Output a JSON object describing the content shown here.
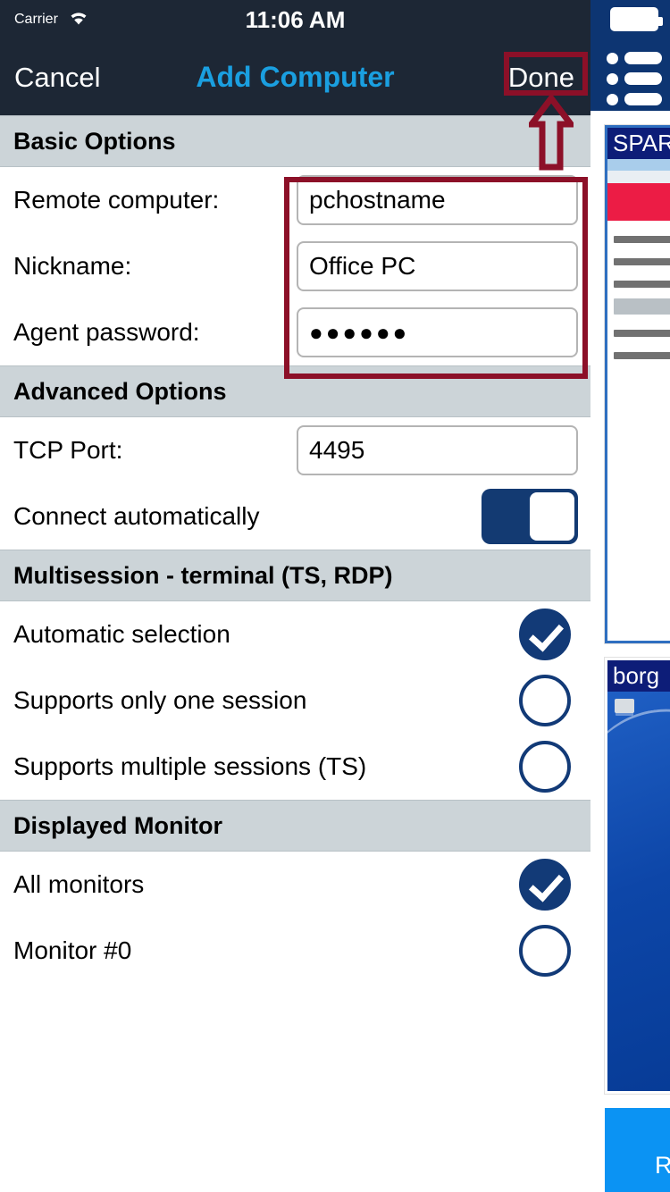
{
  "status_bar": {
    "carrier": "Carrier",
    "wifi_icon": "wifi-icon",
    "time": "11:06 AM"
  },
  "nav_bar": {
    "cancel_label": "Cancel",
    "title": "Add Computer",
    "done_label": "Done",
    "title_color": "#1a9fe0",
    "background_color": "#1d2735"
  },
  "sections": {
    "basic": {
      "header": "Basic Options",
      "rows": [
        {
          "label": "Remote computer:",
          "value": "pchostname",
          "type": "text"
        },
        {
          "label": "Nickname:",
          "value": "Office PC",
          "type": "text"
        },
        {
          "label": "Agent password:",
          "value": "●●●●●●",
          "type": "password"
        }
      ]
    },
    "advanced": {
      "header": "Advanced Options",
      "tcp_port_label": "TCP Port:",
      "tcp_port_value": "4495",
      "connect_auto_label": "Connect automatically",
      "connect_auto_state": "on"
    },
    "multisession": {
      "header": "Multisession - terminal (TS, RDP)",
      "options": [
        {
          "label": "Automatic selection",
          "selected": true
        },
        {
          "label": "Supports only one session",
          "selected": false
        },
        {
          "label": "Supports multiple sessions (TS)",
          "selected": false
        }
      ]
    },
    "monitor": {
      "header": "Displayed Monitor",
      "options": [
        {
          "label": "All monitors",
          "selected": true
        },
        {
          "label": "Monitor #0",
          "selected": false
        }
      ]
    }
  },
  "side_panel": {
    "battery_icon": "battery-icon",
    "menu_icon": "list-menu-icon",
    "thumbnail_1_title": "SPAR",
    "thumbnail_2_title": "borg",
    "action_label": "Rem"
  },
  "annotations": {
    "color": "#8c1028",
    "done_highlight": "done-button",
    "fields_highlight": "basic-options-fields",
    "arrow": "up-arrow pointing at Done"
  },
  "theme": {
    "section_header_bg": "#ccd4d8",
    "accent_blue": "#123a77",
    "toggle_on": "#133a72",
    "side_blue": "#0d3572",
    "action_blue": "#0b93f3"
  }
}
